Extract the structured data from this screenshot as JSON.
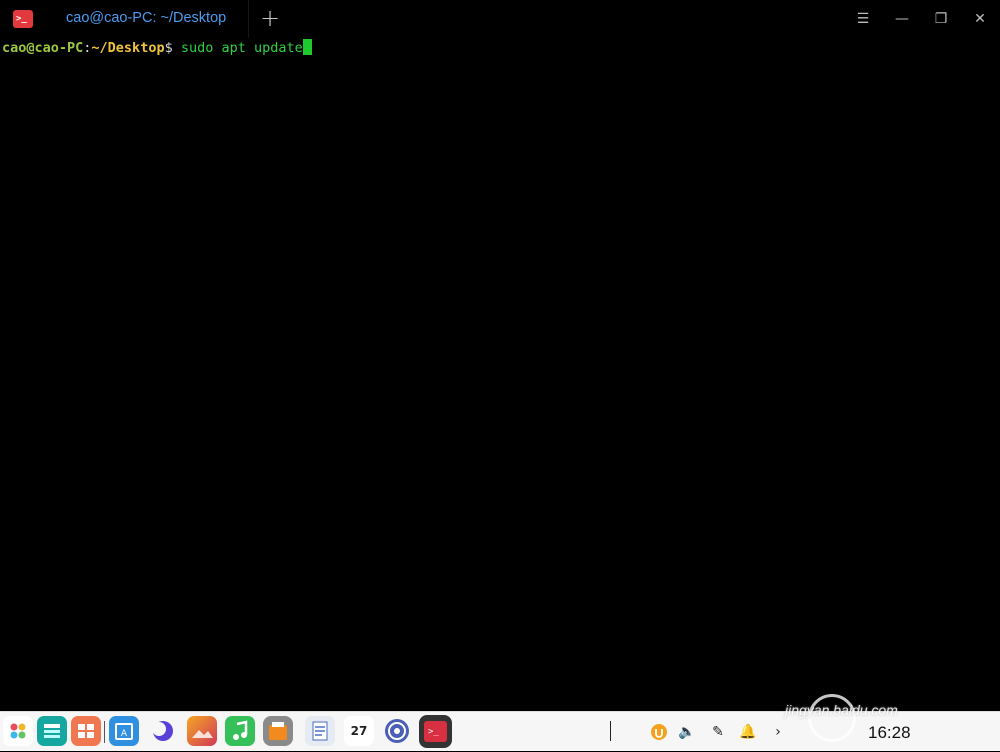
{
  "window": {
    "app_icon": "terminal-icon",
    "tab_title": "cao@cao-PC: ~/Desktop",
    "new_tab_icon": "plus-icon",
    "controls": [
      "menu-icon",
      "minimize-icon",
      "restore-icon",
      "close-icon"
    ]
  },
  "terminal": {
    "prompt_user": "cao@cao-PC",
    "prompt_colon": ":",
    "prompt_path": "~/Desktop",
    "prompt_dollar": "$",
    "command": " sudo apt update"
  },
  "colors": {
    "prompt_user": "#9cc840",
    "prompt_path": "#f0c43a",
    "command": "#2fd044",
    "tab_title": "#4a9cf0",
    "app_icon": "#e0393e"
  },
  "dock": {
    "apps": [
      "launcher-icon",
      "multitasking-icon",
      "app-store-icon",
      "file-manager-icon",
      "browser-icon",
      "image-viewer-icon",
      "music-icon",
      "software-center-icon",
      "document-viewer-icon",
      "calendar-icon",
      "settings-icon",
      "terminal-icon"
    ],
    "calendar_day": "27",
    "tray": [
      "app-update-icon",
      "volume-icon",
      "pen-icon",
      "notification-icon",
      "expand-arrow-icon"
    ],
    "clock": "16:28"
  },
  "watermark": {
    "text": "jingyan.baidu.com"
  }
}
